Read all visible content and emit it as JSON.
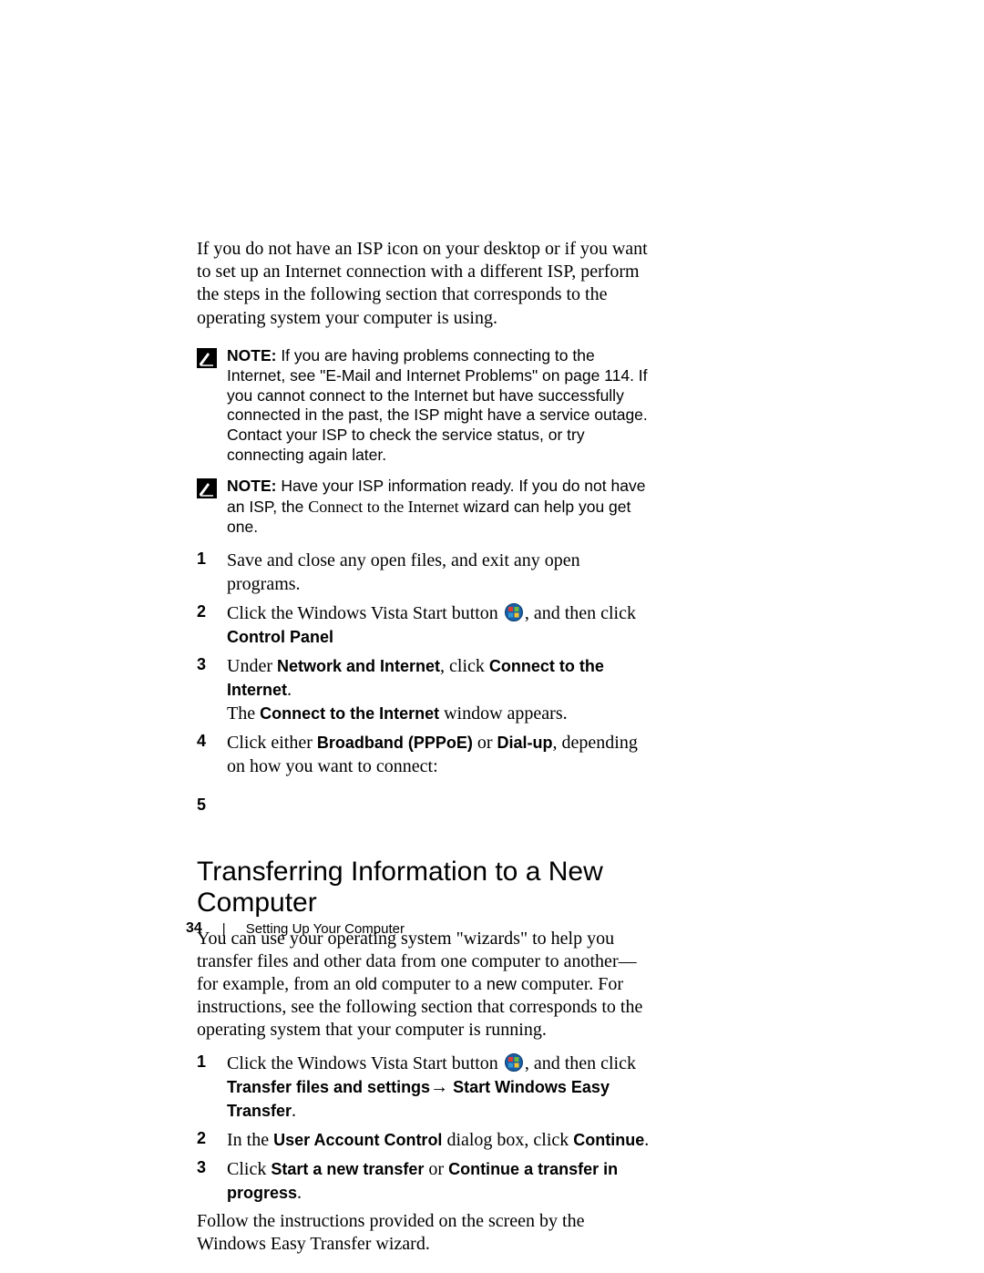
{
  "intro": "If you do not have an ISP icon on your desktop or if you want to set up an Internet connection with a different ISP, perform the steps in the following section that corresponds to the operating system your computer is using.",
  "note1": {
    "label": "NOTE:",
    "text": " If you are having problems connecting to the Internet, see \"E-Mail and Internet Problems\" on page 114. If you cannot connect to the Internet but have successfully connected in the past, the ISP might have a service outage. Contact your ISP to check the service status, or try connecting again later."
  },
  "note2": {
    "label": "NOTE:",
    "text_a": " Have your ISP information ready. If you do not have an ISP, the ",
    "text_serif": "Connect to the Internet",
    "text_b": " wizard can help you get one."
  },
  "steps_a": {
    "s1": "Save and close any open files, and exit any open programs.",
    "s2_a": "Click the Windows Vista Start button ",
    "s2_b": ", and then click ",
    "s2_c": "Control Panel",
    "s3_a": "Under ",
    "s3_b": "Network and Internet",
    "s3_c": ", click ",
    "s3_d": "Connect to the Internet",
    "s3_e": ".",
    "s3_f": "The ",
    "s3_g": "Connect to the Internet",
    "s3_h": " window appears.",
    "s4_a": "Click either ",
    "s4_b": "Broadband (PPPoE)",
    "s4_c": " or ",
    "s4_d": "Dial-up",
    "s4_e": ", depending on how you want to connect:",
    "s5": "…"
  },
  "heading": "Transferring Information to a New Computer",
  "para2_a": "You can use your operating system \"wizards\" to help you transfer files and other data from one computer to another—for example, from an ",
  "para2_old": "old",
  "para2_b": " computer to a ",
  "para2_new": "new",
  "para2_c": " computer. For instructions, see the following section that corresponds to the operating system that your computer is running.",
  "steps_b": {
    "s1_a": "Click the Windows Vista Start button ",
    "s1_b": ", and then click ",
    "s1_c": "Transfer files and settings",
    "s1_arrow": "→",
    "s1_d": "Start Windows Easy Transfer",
    "s1_e": ".",
    "s2_a": "In the ",
    "s2_b": "User Account Control",
    "s2_c": " dialog box, click ",
    "s2_d": "Continue",
    "s2_e": ".",
    "s3_a": "Click ",
    "s3_b": "Start a new transfer",
    "s3_c": " or ",
    "s3_d": "Continue a transfer in progress",
    "s3_e": "."
  },
  "outro": "Follow the instructions provided on the screen by the Windows Easy Transfer wizard.",
  "footer": {
    "page": "34",
    "section": "Setting Up Your Computer"
  }
}
